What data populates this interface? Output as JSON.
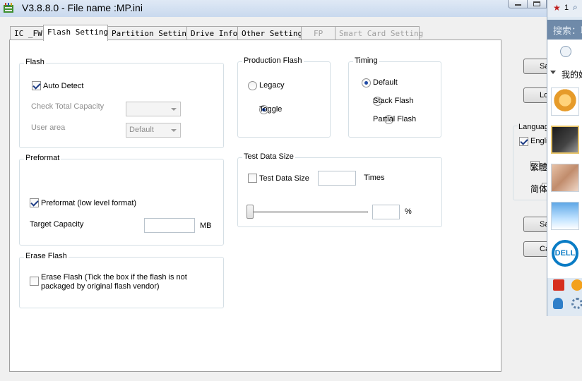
{
  "window": {
    "title": "V3.8.8.0 - File name :MP.ini"
  },
  "tabs": [
    {
      "label": "IC _FW"
    },
    {
      "label": "Flash Setting"
    },
    {
      "label": "Partition Setting"
    },
    {
      "label": "Drive Info"
    },
    {
      "label": "Other Setting"
    },
    {
      "label": "FP"
    },
    {
      "label": "Smart Card Setting"
    }
  ],
  "flash": {
    "title": "Flash",
    "auto_detect": "Auto Detect",
    "check_total_capacity": "Check Total Capacity",
    "check_total_capacity_value": "",
    "user_area": "User area",
    "user_area_value": "Default"
  },
  "production_flash": {
    "title": "Production Flash",
    "legacy": "Legacy",
    "toggle": "Toggle"
  },
  "timing": {
    "title": "Timing",
    "default": "Default",
    "stack": "Stack Flash",
    "partial": "Partial Flash"
  },
  "preformat": {
    "title": "Preformat",
    "checkbox": "Preformat (low level format)",
    "target_capacity": "Target Capacity",
    "target_capacity_value": "",
    "unit": "MB"
  },
  "test_data": {
    "title": "Test Data Size",
    "checkbox": "Test Data Size",
    "times_value": "",
    "times": "Times",
    "percent_value": "",
    "percent": "%"
  },
  "erase": {
    "title": "Erase Flash",
    "line1": "Erase Flash (Tick the box if the flash is not",
    "line2": "packaged by original flash vendor)"
  },
  "side": {
    "btn1": "Sa",
    "btn2": "Lo",
    "language_title": "Languag",
    "lang1": "Engli",
    "lang2": "繁體",
    "lang3": "简体",
    "btn3": "Sav",
    "btn4": "Ca"
  },
  "qq": {
    "badge": "1",
    "search": "搜索：联",
    "friends": "我的好"
  },
  "colors": {
    "selected_radio": "#1f4aa6",
    "search_bar": "#6f8aa9",
    "dell_blue": "#0a7cc5"
  }
}
